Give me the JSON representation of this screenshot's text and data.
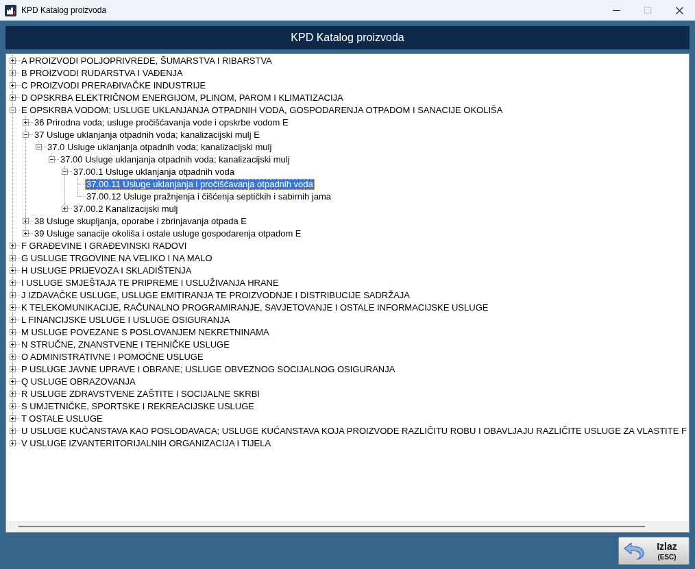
{
  "window": {
    "title": "KPD Katalog proizvoda",
    "controls": [
      {
        "kind": "minimize",
        "disabled": false
      },
      {
        "kind": "maximize",
        "disabled": true
      },
      {
        "kind": "close",
        "disabled": false
      }
    ]
  },
  "header": {
    "title": "KPD Katalog proizvoda"
  },
  "tree": {
    "items": [
      {
        "label": "A PROIZVODI POLJOPRIVREDE, ŠUMARSTVA I RIBARSTVA",
        "kind": "branch",
        "expanded": false,
        "selected": false
      },
      {
        "label": "B PROIZVODI RUDARSTVA I VAĐENJA",
        "kind": "branch",
        "expanded": false,
        "selected": false
      },
      {
        "label": "C PROIZVODI PRERAĐIVAČKE INDUSTRIJE",
        "kind": "branch",
        "expanded": false,
        "selected": false
      },
      {
        "label": "D OPSKRBA ELEKTRIČNOM ENERGIJOM, PLINOM, PAROM I KLIMATIZACIJA",
        "kind": "branch",
        "expanded": false,
        "selected": false
      },
      {
        "label": "E OPSKRBA VODOM; USLUGE UKLANJANJA OTPADNIH VODA, GOSPODARENJA OTPADOM I SANACIJE OKOLIŠA",
        "kind": "branch",
        "expanded": true,
        "selected": false,
        "children": [
          {
            "label": "36 Prirodna voda; usluge pročišćavanja vode i opskrbe vodom E",
            "kind": "branch",
            "expanded": false,
            "selected": false
          },
          {
            "label": "37 Usluge uklanjanja otpadnih voda; kanalizacijski mulj E",
            "kind": "branch",
            "expanded": true,
            "selected": false,
            "children": [
              {
                "label": "37.0 Usluge uklanjanja otpadnih voda; kanalizacijski mulj",
                "kind": "branch",
                "expanded": true,
                "selected": false,
                "children": [
                  {
                    "label": "37.00 Usluge uklanjanja otpadnih voda; kanalizacijski mulj",
                    "kind": "branch",
                    "expanded": true,
                    "selected": false,
                    "children": [
                      {
                        "label": "37.00.1 Usluge uklanjanja otpadnih voda",
                        "kind": "branch",
                        "expanded": true,
                        "selected": false,
                        "children": [
                          {
                            "label": "37.00.11 Usluge uklanjanja i pročišćavanja otpadnih voda",
                            "kind": "leaf",
                            "selected": true
                          },
                          {
                            "label": "37.00.12 Usluge pražnjenja i čišćenja septičkih i sabirnih jama",
                            "kind": "leaf",
                            "selected": false
                          }
                        ]
                      },
                      {
                        "label": "37.00.2 Kanalizacijski mulj",
                        "kind": "branch",
                        "expanded": false,
                        "selected": false
                      }
                    ]
                  }
                ]
              }
            ]
          },
          {
            "label": "38 Usluge skupljanja, oporabe i zbrinjavanja otpada E",
            "kind": "branch",
            "expanded": false,
            "selected": false
          },
          {
            "label": "39 Usluge sanacije okoliša i ostale usluge gospodarenja otpadom E",
            "kind": "branch",
            "expanded": false,
            "selected": false
          }
        ]
      },
      {
        "label": "F GRAĐEVINE I GRAĐEVINSKI RADOVI",
        "kind": "branch",
        "expanded": false,
        "selected": false
      },
      {
        "label": "G USLUGE TRGOVINE NA VELIKO I NA MALO",
        "kind": "branch",
        "expanded": false,
        "selected": false
      },
      {
        "label": "H USLUGE PRIJEVOZA I SKLADIŠTENJA",
        "kind": "branch",
        "expanded": false,
        "selected": false
      },
      {
        "label": "I USLUGE SMJEŠTAJA TE PRIPREME I USLUŽIVANJA HRANE",
        "kind": "branch",
        "expanded": false,
        "selected": false
      },
      {
        "label": "J IZDAVAČKE USLUGE, USLUGE EMITIRANJA TE PROIZVODNJE I DISTRIBUCIJE SADRŽAJA",
        "kind": "branch",
        "expanded": false,
        "selected": false
      },
      {
        "label": "K TELEKOMUNIKACIJE, RAČUNALNO PROGRAMIRANJE, SAVJETOVANJE I OSTALE INFORMACIJSKE USLUGE",
        "kind": "branch",
        "expanded": false,
        "selected": false
      },
      {
        "label": "L FINANCIJSKE USLUGE I USLUGE OSIGURANJA",
        "kind": "branch",
        "expanded": false,
        "selected": false
      },
      {
        "label": "M USLUGE POVEZANE S POSLOVANJEM NEKRETNINAMA",
        "kind": "branch",
        "expanded": false,
        "selected": false
      },
      {
        "label": "N STRUČNE, ZNANSTVENE I TEHNIČKE USLUGE",
        "kind": "branch",
        "expanded": false,
        "selected": false
      },
      {
        "label": "O ADMINISTRATIVNE I POMOĆNE USLUGE",
        "kind": "branch",
        "expanded": false,
        "selected": false
      },
      {
        "label": "P USLUGE JAVNE UPRAVE I OBRANE; USLUGE OBVEZNOG SOCIJALNOG OSIGURANJA",
        "kind": "branch",
        "expanded": false,
        "selected": false
      },
      {
        "label": "Q USLUGE OBRAZOVANJA",
        "kind": "branch",
        "expanded": false,
        "selected": false
      },
      {
        "label": "R USLUGE ZDRAVSTVENE ZAŠTITE I SOCIJALNE SKRBI",
        "kind": "branch",
        "expanded": false,
        "selected": false
      },
      {
        "label": "S UMJETNIČKE, SPORTSKE I REKREACIJSKE USLUGE",
        "kind": "branch",
        "expanded": false,
        "selected": false
      },
      {
        "label": "T OSTALE USLUGE",
        "kind": "branch",
        "expanded": false,
        "selected": false
      },
      {
        "label": "U USLUGE KUĆANSTAVA KAO POSLODAVACA; USLUGE KUĆANSTAVA KOJA PROIZVODE RAZLIČITU ROBU I OBAVLJAJU RAZLIČITE USLUGE ZA VLASTITE F",
        "kind": "branch",
        "expanded": false,
        "selected": false
      },
      {
        "label": "V USLUGE IZVANTERITORIJALNIH ORGANIZACIJA I TIJELA",
        "kind": "branch",
        "expanded": false,
        "selected": false
      }
    ]
  },
  "footer": {
    "exit_button": {
      "label": "Izlaz",
      "shortcut": "(ESC)"
    }
  }
}
